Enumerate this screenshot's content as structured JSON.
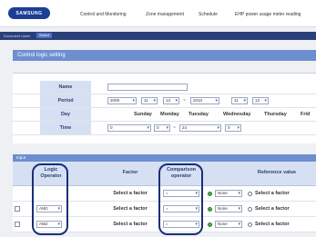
{
  "header": {
    "logo_text": "SAMSUNG",
    "nav": [
      "Control and Monitoring",
      "Zone management",
      "Schedule",
      "EHP power usage meter reading"
    ]
  },
  "subbar": {
    "label": "Document name",
    "tag": "Select"
  },
  "panel": {
    "title": "Control logic setting"
  },
  "form": {
    "name_label": "Name",
    "name_value": "",
    "period_label": "Period",
    "period": {
      "from_year": "2009",
      "from_month": "11",
      "from_day": "13",
      "tilde": "~",
      "to_year": "2010",
      "to_month": "11",
      "to_day": "13"
    },
    "day_label": "Day",
    "days": [
      "Sunday",
      "Monday",
      "Tuesday",
      "Wednesday",
      "Thursday",
      "Frid"
    ],
    "time_label": "Time",
    "time": {
      "from_h": "0",
      "from_m": "0",
      "tilde": "~",
      "to_h": "24",
      "to_m": "0"
    }
  },
  "input": {
    "section_label": "Input",
    "headers": {
      "logic_operator": [
        "Logic",
        "Operator"
      ],
      "factor": "Factor",
      "comparison_operator": [
        "Comparison",
        "operator"
      ],
      "reference_value": "Reference value"
    },
    "rows": [
      {
        "logic": "",
        "factor": "Select a factor",
        "comparison": "=",
        "ref_select": "None",
        "ref_factor": "Select a factor"
      },
      {
        "logic": "AND",
        "factor": "Select a factor",
        "comparison": "=",
        "ref_select": "None",
        "ref_factor": "Select a factor"
      },
      {
        "logic": "AND",
        "factor": "Select a factor",
        "comparison": "=",
        "ref_select": "None",
        "ref_factor": "Select a factor"
      }
    ]
  },
  "colors": {
    "header_bg": "#ffffff",
    "subbar_bg": "#2a3f7a",
    "panel_title_bg": "#6d8fcf",
    "label_bg": "#d7e0f3",
    "highlight": "#17307a"
  }
}
